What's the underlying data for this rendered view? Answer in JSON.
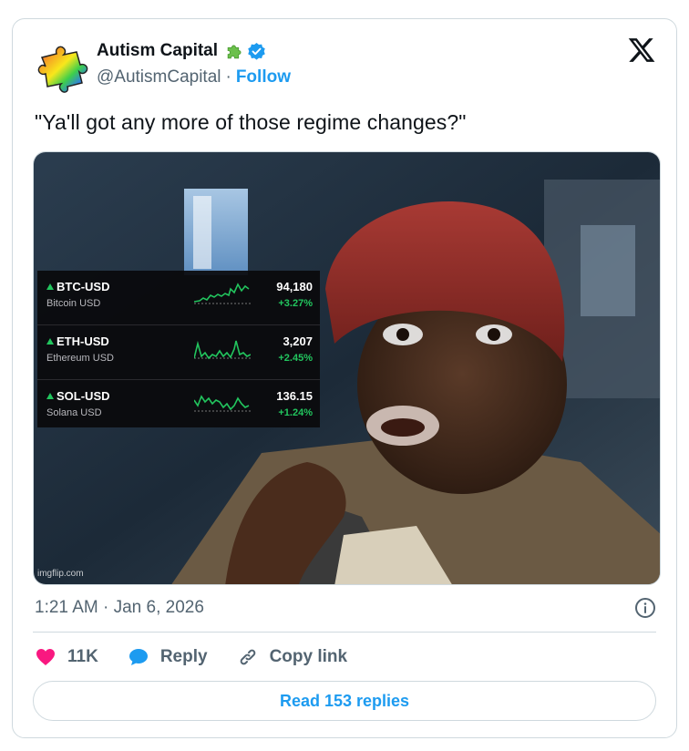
{
  "author": {
    "name": "Autism Capital",
    "handle": "@AutismCapital",
    "separator": "·",
    "follow_label": "Follow",
    "verified_color": "#1d9bf0",
    "badge_icon": "puzzle-piece-icon"
  },
  "tweet": {
    "text": "\"Ya'll got any more of those regime changes?\"",
    "timestamp": "1:21 AM · Jan 6, 2026"
  },
  "media": {
    "watermark": "imgflip.com",
    "tickers": [
      {
        "symbol": "BTC-USD",
        "name": "Bitcoin USD",
        "price": "94,180",
        "change": "+3.27%"
      },
      {
        "symbol": "ETH-USD",
        "name": "Ethereum USD",
        "price": "3,207",
        "change": "+2.45%"
      },
      {
        "symbol": "SOL-USD",
        "name": "Solana USD",
        "price": "136.15",
        "change": "+1.24%"
      }
    ],
    "up_color": "#22c55e"
  },
  "actions": {
    "like_count": "11K",
    "reply_label": "Reply",
    "copy_label": "Copy link"
  },
  "read_replies_label": "Read 153 replies",
  "colors": {
    "accent": "#1d9bf0",
    "like": "#f91880",
    "muted": "#536471",
    "border": "#cfd9de"
  }
}
